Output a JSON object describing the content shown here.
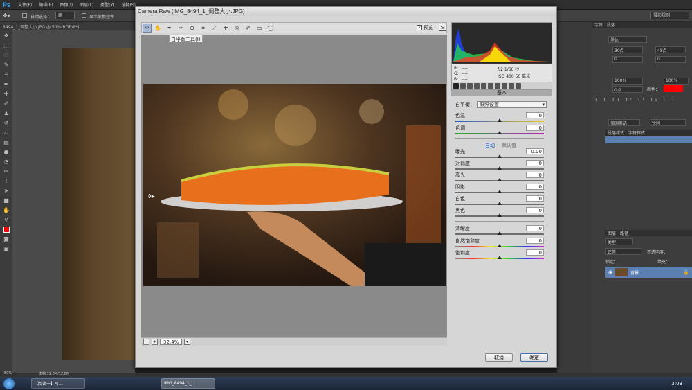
{
  "app": {
    "logo": "Ps",
    "menu": [
      "文件(F)",
      "编辑(E)",
      "图像(I)",
      "图层(L)",
      "类型(Y)",
      "选择(S)"
    ],
    "doc_tab": "8494_1_调整大小.JPG @ 50%(RGB/8*)",
    "options": {
      "auto_select": "自动选择：",
      "auto_select_value": "组",
      "transform": "显示变换控件",
      "workspace": "摄影规则"
    }
  },
  "dialog": {
    "title": "Camera Raw (IMG_8494_1_调整大小.JPG)",
    "tooltip": "白平衡工具(I)",
    "preview_label": "预览",
    "zoom_value": "32.4%",
    "cancel": "取消",
    "ok": "确定"
  },
  "histogram": {
    "r": "R:",
    "g": "G:",
    "b": "B:",
    "r_val": "----",
    "g_val": "----",
    "b_val": "----",
    "exposure_info": "f/2  1/60 秒",
    "iso_info": "ISO 400  50 毫米"
  },
  "basic": {
    "section_title": "基本",
    "wb_label": "白平衡：",
    "wb_value": "原照设置",
    "auto": "自动",
    "default": "默认值",
    "sliders": [
      {
        "label": "色温",
        "value": "0"
      },
      {
        "label": "色调",
        "value": "0"
      },
      {
        "label": "曝光",
        "value": "0.00"
      },
      {
        "label": "对比度",
        "value": "0"
      },
      {
        "label": "高光",
        "value": "0"
      },
      {
        "label": "阴影",
        "value": "0"
      },
      {
        "label": "白色",
        "value": "0"
      },
      {
        "label": "黑色",
        "value": "0"
      },
      {
        "label": "清晰度",
        "value": "0"
      },
      {
        "label": "自然饱和度",
        "value": "0"
      },
      {
        "label": "饱和度",
        "value": "0"
      }
    ]
  },
  "right_panel": {
    "char_tab": "字符",
    "para_tab": "段落",
    "font": "黑体",
    "size": "30点",
    "leading": "48点",
    "tracking": "0",
    "kerning": "0",
    "scale_v": "100%",
    "scale_h": "100%",
    "baseline": "0点",
    "color_label": "颜色：",
    "language": "美国英语",
    "aa": "锐利",
    "styles_tab1": "段落样式",
    "styles_tab2": "字符样式",
    "layers_tab": "图层",
    "paths_tab": "路径",
    "kind": "类型",
    "blend": "正常",
    "opacity_label": "不透明度：",
    "lock_label": "锁定：",
    "fill_label": "填充：",
    "layer_name": "背景"
  },
  "status": {
    "zoom": "50%",
    "doc": "文档:12.8M/12.8M"
  },
  "taskbar": {
    "item1": "【阅读一】写...",
    "item2": "IMG_8494_1_...",
    "clock": "3:03"
  }
}
